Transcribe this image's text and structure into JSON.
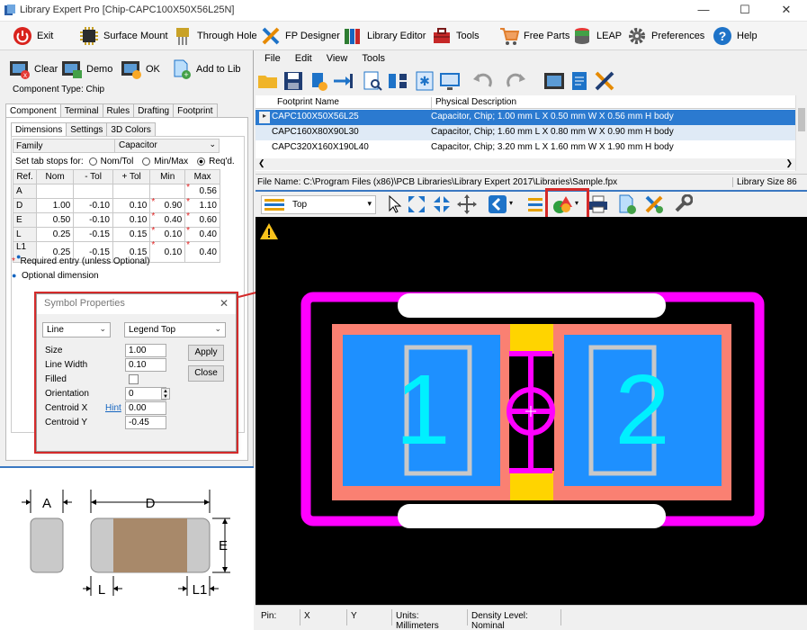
{
  "window": {
    "title": "Library Expert Pro [Chip-CAPC100X50X56L25N]"
  },
  "main_toolbar": [
    "Exit",
    "Surface Mount",
    "Through Hole",
    "FP Designer",
    "Library Editor",
    "Tools",
    "Free Parts",
    "LEAP",
    "Preferences",
    "Help"
  ],
  "left": {
    "buttons": [
      "Clear",
      "Demo",
      "OK",
      "Add to Lib"
    ],
    "component_type": "Component Type: Chip",
    "tabs": [
      "Component",
      "Terminal",
      "Rules",
      "Drafting",
      "Footprint"
    ],
    "subtabs": [
      "Dimensions",
      "Settings",
      "3D Colors"
    ],
    "family_label": "Family",
    "family_value": "Capacitor",
    "tabstops_label": "Set tab stops for:",
    "tabstops_options": [
      "Nom/Tol",
      "Min/Max",
      "Req'd."
    ],
    "table_headers": [
      "Ref.",
      "Nom",
      "- Tol",
      "+ Tol",
      "Min",
      "Max"
    ],
    "rows": [
      [
        "A",
        "",
        "",
        "",
        "",
        "0.56"
      ],
      [
        "D",
        "1.00",
        "-0.10",
        "0.10",
        "0.90",
        "1.10"
      ],
      [
        "E",
        "0.50",
        "-0.10",
        "0.10",
        "0.40",
        "0.60"
      ],
      [
        "L",
        "0.25",
        "-0.15",
        "0.15",
        "0.10",
        "0.40"
      ],
      [
        "L1",
        "0.25",
        "-0.15",
        "0.15",
        "0.10",
        "0.40"
      ]
    ],
    "legend_required": "Required entry (unless Optional)",
    "legend_optional": "Optional dimension",
    "diagram_labels": {
      "a": "A",
      "d": "D",
      "e": "E",
      "l": "L",
      "l1": "L1"
    }
  },
  "symbol_dialog": {
    "title": "Symbol Properties",
    "shape": "Line",
    "layer": "Legend Top",
    "size_label": "Size",
    "size": "1.00",
    "linewidth_label": "Line Width",
    "linewidth": "0.10",
    "filled_label": "Filled",
    "orientation_label": "Orientation",
    "orientation": "0",
    "centroid_x_label": "Centroid X",
    "hint": "Hint",
    "centroid_x": "0.00",
    "centroid_y_label": "Centroid Y",
    "centroid_y": "-0.45",
    "apply": "Apply",
    "close": "Close"
  },
  "right": {
    "menu": [
      "File",
      "Edit",
      "View",
      "Tools"
    ],
    "columns": [
      "Footprint Name",
      "Physical Description"
    ],
    "rows": [
      {
        "name": "CAPC100X50X56L25",
        "desc": "Capacitor, Chip; 1.00 mm L X 0.50 mm W X 0.56 mm H body"
      },
      {
        "name": "CAPC160X80X90L30",
        "desc": "Capacitor, Chip; 1.60 mm L X 0.80 mm W X 0.90 mm H body"
      },
      {
        "name": "CAPC320X160X190L40",
        "desc": "Capacitor, Chip; 3.20 mm L X 1.60 mm W X 1.90 mm H body"
      }
    ],
    "file_name": "File Name:  C:\\Program Files (x86)\\PCB Libraries\\Library Expert 2017\\Libraries\\Sample.fpx",
    "library_size": "Library Size  86",
    "layer": "Top",
    "pad1": "1",
    "pad2": "2",
    "status": {
      "pin": "Pin:",
      "x": "X",
      "y": "Y",
      "units": "Units: Millimeters",
      "density": "Density Level: Nominal"
    }
  },
  "colors": {
    "accent": "#3a78c2",
    "highlight": "#e0262b",
    "pad": "#1e90ff",
    "silk": "#ff00ff"
  }
}
